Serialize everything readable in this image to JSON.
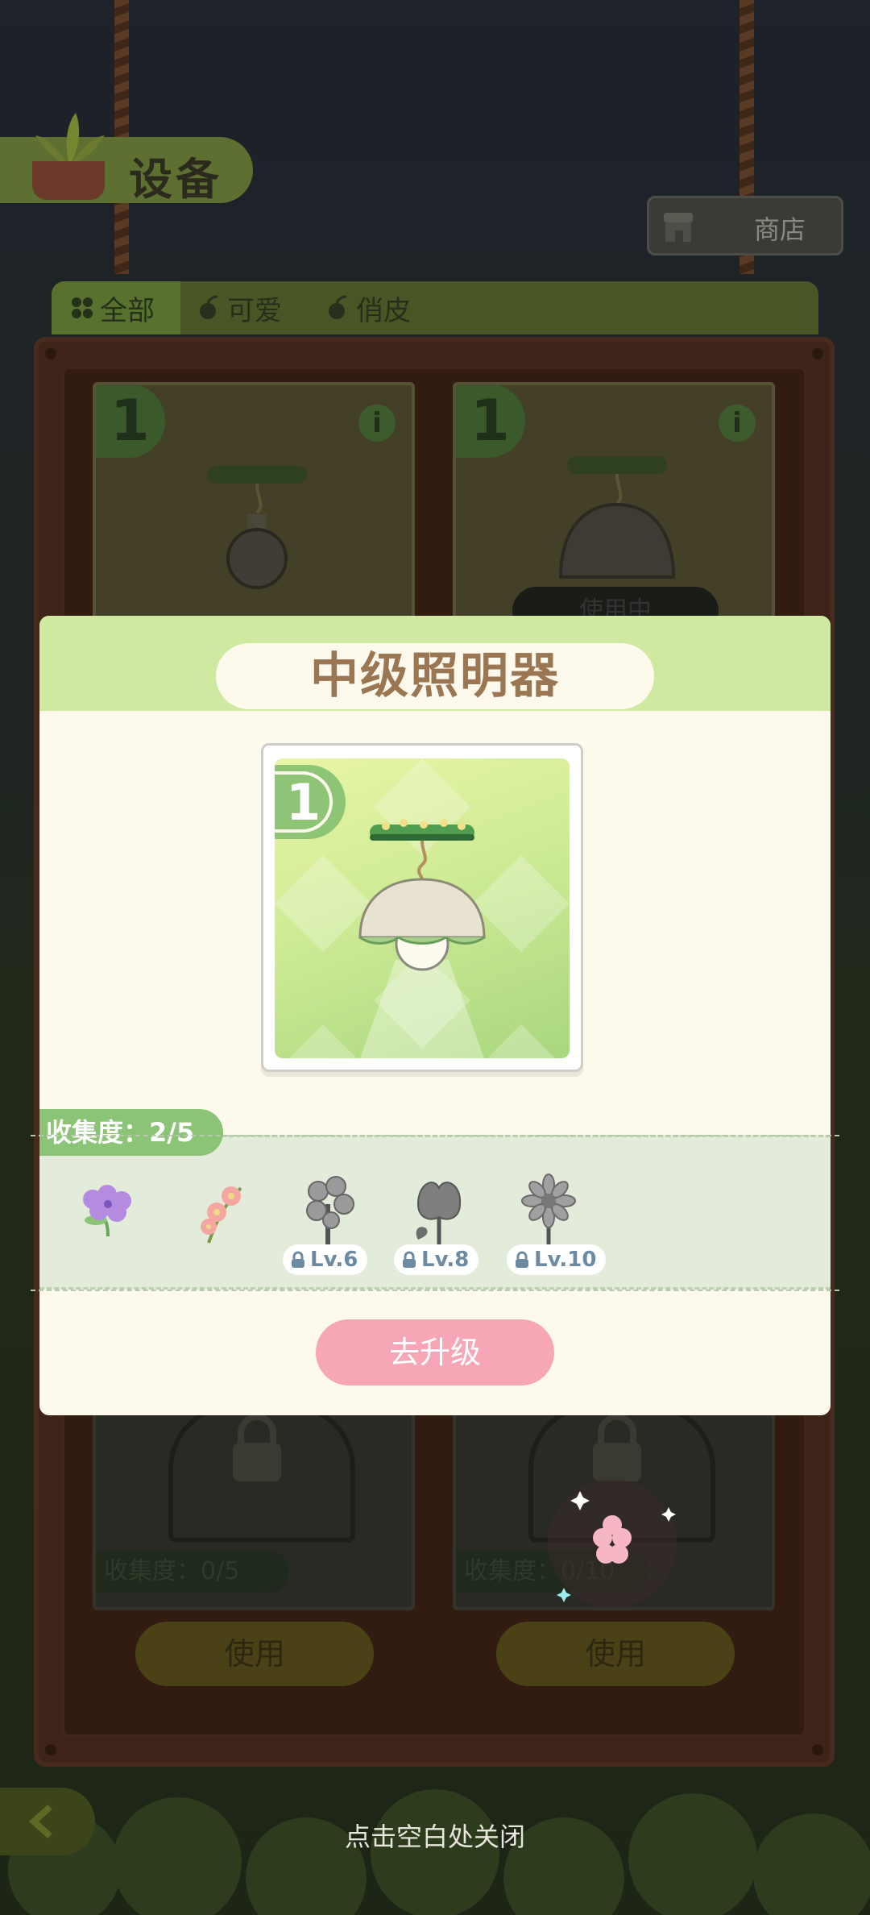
{
  "header": {
    "title": "设备",
    "shop_label": "商店"
  },
  "tabs": [
    {
      "label": "全部",
      "active": true
    },
    {
      "label": "可爱",
      "active": false
    },
    {
      "label": "俏皮",
      "active": false
    }
  ],
  "cards": [
    {
      "level": "1",
      "in_use_label": ""
    },
    {
      "level": "1",
      "in_use_label": "使用中"
    }
  ],
  "locked_cards": [
    {
      "collect_label": "收集度：0/5"
    },
    {
      "collect_label": "收集度：0/10"
    }
  ],
  "use_buttons": [
    "使用",
    "使用"
  ],
  "modal": {
    "title": "中级照明器",
    "level": "1",
    "collection_label": "收集度：2/5",
    "flowers": [
      {
        "name": "purple-flower",
        "unlocked": true,
        "level_label": ""
      },
      {
        "name": "pink-blossom",
        "unlocked": true,
        "level_label": ""
      },
      {
        "name": "grey-cherry-blossom",
        "unlocked": false,
        "level_label": "Lv.6"
      },
      {
        "name": "grey-leafy-flower",
        "unlocked": false,
        "level_label": "Lv.8"
      },
      {
        "name": "grey-daisy",
        "unlocked": false,
        "level_label": "Lv.10"
      }
    ],
    "upgrade_label": "去升级"
  },
  "close_hint": "点击空白处关闭",
  "colors": {
    "accent_green": "#8cc477",
    "upgrade_pink": "#f6a6b4",
    "title_brown": "#9a7653"
  }
}
